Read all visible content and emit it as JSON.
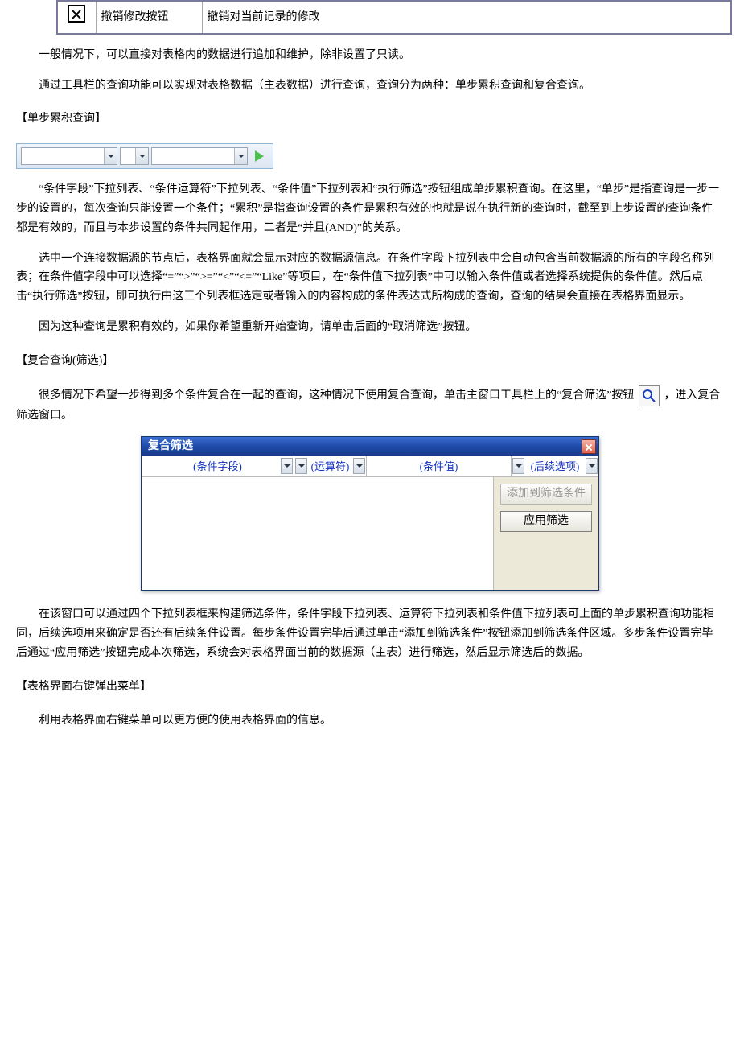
{
  "top_table": {
    "button_name": "撤销修改按钮",
    "description": "撤销对当前记录的修改"
  },
  "paragraphs": {
    "p1": "一般情况下，可以直接对表格内的数据进行追加和维护，除非设置了只读。",
    "p2": "通过工具栏的查询功能可以实现对表格数据（主表数据）进行查询，查询分为两种：单步累积查询和复合查询。",
    "sec_single": "【单步累积查询】",
    "p3": "“条件字段”下拉列表、“条件运算符”下拉列表、“条件值”下拉列表和“执行筛选”按钮组成单步累积查询。在这里，“单步”是指查询是一步一步的设置的，每次查询只能设置一个条件；“累积”是指查询设置的条件是累积有效的也就是说在执行新的查询时，截至到上步设置的查询条件都是有效的，而且与本步设置的条件共同起作用，二者是“并且(AND)”的关系。",
    "p4": "选中一个连接数据源的节点后，表格界面就会显示对应的数据源信息。在条件字段下拉列表中会自动包含当前数据源的所有的字段名称列表；在条件值字段中可以选择“=”“>”“>=”“<”“<=”“Like”等项目，在“条件值下拉列表”中可以输入条件值或者选择系统提供的条件值。然后点击“执行筛选”按钮，即可执行由这三个列表框选定或者输入的内容构成的条件表达式所构成的查询，查询的结果会直接在表格界面显示。",
    "p5": "因为这种查询是累积有效的，如果你希望重新开始查询，请单击后面的“取消筛选”按钮。",
    "sec_composite": "【复合查询(筛选)】",
    "p6_before": "很多情况下希望一步得到多个条件复合在一起的查询，这种情况下使用复合查询，单击主窗口工具栏上的“复合筛选”按钮",
    "p6_after": "，进入复合筛选窗口。",
    "p7": "在该窗口可以通过四个下拉列表框来构建筛选条件，条件字段下拉列表、运算符下拉列表和条件值下拉列表可上面的单步累积查询功能相同，后续选项用来确定是否还有后续条件设置。每步条件设置完毕后通过单击“添加到筛选条件”按钮添加到筛选条件区域。多步条件设置完毕后通过“应用筛选”按钮完成本次筛选，系统会对表格界面当前的数据源（主表）进行筛选，然后显示筛选后的数据。",
    "sec_context": "【表格界面右键弹出菜单】",
    "p8": "利用表格界面右键菜单可以更方便的使用表格界面的信息。"
  },
  "filter_window": {
    "title": "复合筛选",
    "field_label": "(条件字段)",
    "op_label": "(运算符)",
    "val_label": "(条件值)",
    "next_label": "(后续选项)",
    "btn_add": "添加到筛选条件",
    "btn_apply": "应用筛选"
  }
}
